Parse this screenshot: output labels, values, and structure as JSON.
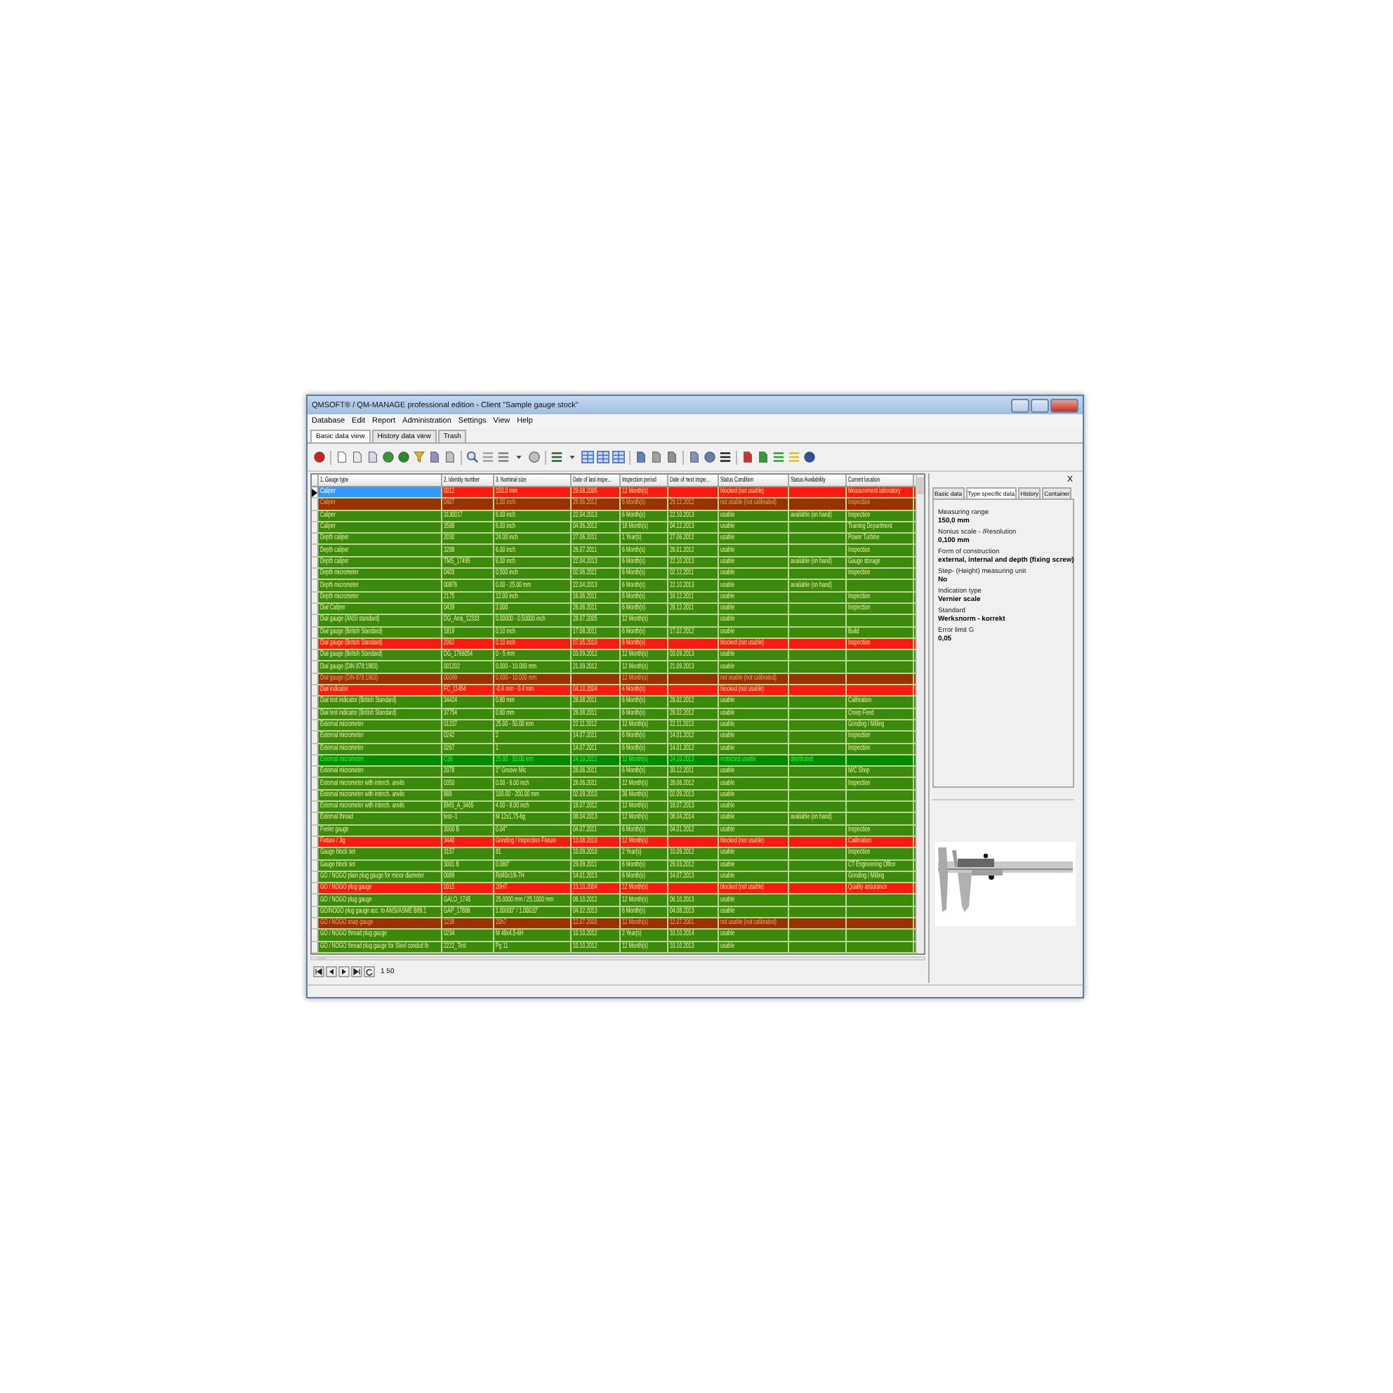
{
  "window": {
    "title": "QMSOFT® / QM-MANAGE professional edition - Client \"Sample gauge stock\""
  },
  "menu": [
    "Database",
    "Edit",
    "Report",
    "Administration",
    "Settings",
    "View",
    "Help"
  ],
  "tabs": [
    {
      "label": "Basic data view",
      "selected": true
    },
    {
      "label": "History data view",
      "selected": false
    },
    {
      "label": "Trash",
      "selected": false
    }
  ],
  "table": {
    "columns": [
      "1. Gauge type",
      "2. Identity number",
      "3. Nominal size",
      "Date of last inspe...",
      "Inspection period",
      "Date of next inspe...",
      "Status Condition",
      "Status Availability",
      "Current location"
    ],
    "rows": [
      {
        "kind": "red",
        "selected": true,
        "gauge_type": "Caliper",
        "identity_number": "0012",
        "nominal_size": "150.0 mm",
        "last_inspection": "29.08.2005",
        "inspection_period": "12 Month(s)",
        "condition": "blocked (not usable)",
        "location": "Measurement laboratory"
      },
      {
        "kind": "brown",
        "selected": false,
        "gauge_type": "Caliper",
        "identity_number": "0407",
        "nominal_size": "1.00 inch",
        "last_inspection": "29.06.2012",
        "inspection_period": "6 Month(s)",
        "next_inspection": "29.12.2012",
        "condition": "not usable (not calibrated)",
        "location": "Inspection"
      },
      {
        "kind": "green",
        "selected": false,
        "gauge_type": "Caliper",
        "identity_number": "3130017",
        "nominal_size": "6.00 inch",
        "last_inspection": "22.04.2013",
        "inspection_period": "6 Month(s)",
        "next_inspection": "22.10.2013",
        "condition": "usable",
        "availability": "available (on hand)",
        "location": "Inspection"
      },
      {
        "kind": "green",
        "selected": false,
        "gauge_type": "Caliper",
        "identity_number": "3588",
        "nominal_size": "6.00 inch",
        "last_inspection": "04.06.2012",
        "inspection_period": "18 Month(s)",
        "next_inspection": "04.12.2013",
        "condition": "usable",
        "location": "Training Department"
      },
      {
        "kind": "green",
        "selected": false,
        "gauge_type": "Depth caliper",
        "identity_number": "2030",
        "nominal_size": "24.00 inch",
        "last_inspection": "27.06.2011",
        "inspection_period": "1 Year(s)",
        "next_inspection": "27.06.2012",
        "condition": "usable",
        "location": "Power Turbine"
      },
      {
        "kind": "green",
        "selected": false,
        "gauge_type": "Depth caliper",
        "identity_number": "3288",
        "nominal_size": "6.00 inch",
        "last_inspection": "26.07.2011",
        "inspection_period": "6 Month(s)",
        "next_inspection": "26.01.2012",
        "condition": "usable",
        "location": "Inspection"
      },
      {
        "kind": "green",
        "selected": false,
        "gauge_type": "Depth caliper",
        "identity_number": "TMS_17495",
        "nominal_size": "6.00 inch",
        "last_inspection": "22.04.2013",
        "inspection_period": "6 Month(s)",
        "next_inspection": "22.10.2013",
        "condition": "usable",
        "availability": "available (on hand)",
        "location": "Gauge storage"
      },
      {
        "kind": "green",
        "selected": false,
        "gauge_type": "Depth micrometer",
        "identity_number": "0403",
        "nominal_size": "0.500 inch",
        "last_inspection": "02.06.2011",
        "inspection_period": "6 Month(s)",
        "next_inspection": "02.12.2011",
        "condition": "usable",
        "location": "Inspection"
      },
      {
        "kind": "green",
        "selected": false,
        "gauge_type": "Depth micrometer",
        "identity_number": "00876",
        "nominal_size": "0.00 - 25.00 mm",
        "last_inspection": "22.04.2013",
        "inspection_period": "6 Month(s)",
        "next_inspection": "22.10.2013",
        "condition": "usable",
        "availability": "available (on hand)"
      },
      {
        "kind": "green",
        "selected": false,
        "gauge_type": "Depth micrometer",
        "identity_number": "2175",
        "nominal_size": "12.00 inch",
        "last_inspection": "16.06.2011",
        "inspection_period": "6 Month(s)",
        "next_inspection": "16.12.2011",
        "condition": "usable",
        "location": "Inspection"
      },
      {
        "kind": "green",
        "selected": false,
        "gauge_type": "Dial Caliper",
        "identity_number": "0439",
        "nominal_size": "2.000",
        "last_inspection": "28.06.2011",
        "inspection_period": "6 Month(s)",
        "next_inspection": "28.12.2011",
        "condition": "usable",
        "location": "Inspection"
      },
      {
        "kind": "green",
        "selected": false,
        "gauge_type": "Dial gauge (ANSI standard)",
        "identity_number": "DG_Ansi_12333",
        "nominal_size": "0.00000 - 0.50000 inch",
        "last_inspection": "28.07.2005",
        "inspection_period": "12 Month(s)",
        "condition": "usable"
      },
      {
        "kind": "green",
        "selected": false,
        "gauge_type": "Dial gauge (British Standard)",
        "identity_number": "1819",
        "nominal_size": "0.10 inch",
        "last_inspection": "17.08.2011",
        "inspection_period": "6 Month(s)",
        "next_inspection": "17.02.2012",
        "condition": "usable",
        "location": "Build"
      },
      {
        "kind": "red",
        "selected": false,
        "gauge_type": "Dial gauge (British Standard)",
        "identity_number": "2062",
        "nominal_size": "0.10 inch",
        "last_inspection": "07.05.2010",
        "inspection_period": "6 Month(s)",
        "condition": "blocked (not usable)",
        "location": "Inspection"
      },
      {
        "kind": "green",
        "selected": false,
        "gauge_type": "Dial gauge (British Standard)",
        "identity_number": "DG_1766054",
        "nominal_size": "0 - 5 mm",
        "last_inspection": "03.09.2012",
        "inspection_period": "12 Month(s)",
        "next_inspection": "03.09.2013",
        "condition": "usable"
      },
      {
        "kind": "green",
        "selected": false,
        "gauge_type": "Dial gauge (DIN 878:1983)",
        "identity_number": "001202",
        "nominal_size": "0.000 - 10.000 mm",
        "last_inspection": "21.09.2012",
        "inspection_period": "12 Month(s)",
        "next_inspection": "21.09.2013",
        "condition": "usable"
      },
      {
        "kind": "brown",
        "selected": false,
        "gauge_type": "Dial gauge (DIN 878:1983)",
        "identity_number": "00099",
        "nominal_size": "0.000 - 10.000 mm",
        "inspection_period": "12 Month(s)",
        "condition": "not usable (not calibrated)"
      },
      {
        "kind": "red",
        "selected": false,
        "gauge_type": "Dial indicator",
        "identity_number": "FC_11454",
        "nominal_size": "-0.4 mm - 0.4 mm",
        "last_inspection": "04.10.2004",
        "inspection_period": "4 Month(s)",
        "condition": "blocked (not usable)"
      },
      {
        "kind": "green",
        "selected": false,
        "gauge_type": "Dial test indicator (British Standard)",
        "identity_number": "34424",
        "nominal_size": "0.80 mm",
        "last_inspection": "28.08.2011",
        "inspection_period": "6 Month(s)",
        "next_inspection": "28.02.2012",
        "condition": "usable",
        "location": "Calibration"
      },
      {
        "kind": "green",
        "selected": false,
        "gauge_type": "Dial test indicator (British Standard)",
        "identity_number": "37754",
        "nominal_size": "0.80 mm",
        "last_inspection": "28.08.2011",
        "inspection_period": "6 Month(s)",
        "next_inspection": "28.02.2012",
        "condition": "usable",
        "location": "Creep Feed"
      },
      {
        "kind": "green",
        "selected": false,
        "gauge_type": "External micrometer",
        "identity_number": "01237",
        "nominal_size": "25.00 - 50.00 mm",
        "last_inspection": "22.11.2012",
        "inspection_period": "12 Month(s)",
        "next_inspection": "22.11.2013",
        "condition": "usable",
        "location": "Grinding / Milling"
      },
      {
        "kind": "green",
        "selected": false,
        "gauge_type": "External micrometer",
        "identity_number": "0242",
        "nominal_size": "2",
        "last_inspection": "14.07.2011",
        "inspection_period": "6 Month(s)",
        "next_inspection": "14.01.2012",
        "condition": "usable",
        "location": "Inspection"
      },
      {
        "kind": "green",
        "selected": false,
        "gauge_type": "External micrometer",
        "identity_number": "0267",
        "nominal_size": "1",
        "last_inspection": "14.07.2011",
        "inspection_period": "6 Month(s)",
        "next_inspection": "14.01.2012",
        "condition": "usable",
        "location": "Inspection"
      },
      {
        "kind": "bright",
        "selected": false,
        "gauge_type": "External micrometer",
        "identity_number": "C36",
        "nominal_size": "25.00 - 50.00 mm",
        "last_inspection": "24.10.2012",
        "inspection_period": "12 Month(s)",
        "next_inspection": "24.10.2013",
        "condition": "restricted usable",
        "availability": "distributed"
      },
      {
        "kind": "green",
        "selected": false,
        "gauge_type": "External micrometer",
        "identity_number": "2078",
        "nominal_size": "1\" Groove Mic",
        "last_inspection": "28.06.2011",
        "inspection_period": "6 Month(s)",
        "next_inspection": "30.12.2011",
        "condition": "usable",
        "location": "M/C Shop"
      },
      {
        "kind": "green",
        "selected": false,
        "gauge_type": "External micrometer with interch. anvils",
        "identity_number": "0350",
        "nominal_size": "0.00 - 6.00 inch",
        "last_inspection": "28.06.2011",
        "inspection_period": "12 Month(s)",
        "next_inspection": "28.06.2012",
        "condition": "usable",
        "location": "Inspection"
      },
      {
        "kind": "green",
        "selected": false,
        "gauge_type": "External micrometer with interch. anvils",
        "identity_number": "888",
        "nominal_size": "100.00 - 200.00 mm",
        "last_inspection": "02.09.2010",
        "inspection_period": "36 Month(s)",
        "next_inspection": "02.09.2013",
        "condition": "usable"
      },
      {
        "kind": "green",
        "selected": false,
        "gauge_type": "External micrometer with interch. anvils",
        "identity_number": "BMS_A_3465",
        "nominal_size": "4.00 - 8.00 inch",
        "last_inspection": "18.07.2012",
        "inspection_period": "12 Month(s)",
        "next_inspection": "18.07.2013",
        "condition": "usable"
      },
      {
        "kind": "green",
        "selected": false,
        "gauge_type": "External thread",
        "identity_number": "test--1",
        "nominal_size": "M 12x1.75-6g",
        "last_inspection": "08.04.2013",
        "inspection_period": "12 Month(s)",
        "next_inspection": "08.04.2014",
        "condition": "usable",
        "availability": "available (on hand)"
      },
      {
        "kind": "green",
        "selected": false,
        "gauge_type": "Feeler gauge",
        "identity_number": "3000 B",
        "nominal_size": "0.04\"",
        "last_inspection": "04.07.2011",
        "inspection_period": "6 Month(s)",
        "next_inspection": "04.01.2012",
        "condition": "usable",
        "location": "Inspection"
      },
      {
        "kind": "red",
        "selected": false,
        "gauge_type": "Fixture / Jig",
        "identity_number": "3440",
        "nominal_size": "Grinding / Inspection Fixture",
        "last_inspection": "13.08.2010",
        "inspection_period": "12 Month(s)",
        "condition": "blocked (not usable)",
        "location": "Calibration"
      },
      {
        "kind": "green",
        "selected": false,
        "gauge_type": "Gauge block set",
        "identity_number": "3157",
        "nominal_size": "81",
        "last_inspection": "10.09.2010",
        "inspection_period": "2 Year(s)",
        "next_inspection": "10.09.2012",
        "condition": "usable",
        "location": "Inspection"
      },
      {
        "kind": "green",
        "selected": false,
        "gauge_type": "Gauge block set",
        "identity_number": "3001 B",
        "nominal_size": "0.080\"",
        "last_inspection": "29.09.2011",
        "inspection_period": "6 Month(s)",
        "next_inspection": "29.03.2012",
        "condition": "usable",
        "location": "CT Engineering Office"
      },
      {
        "kind": "green",
        "selected": false,
        "gauge_type": "GO / NOGO plain plug gauge for minor diameter",
        "identity_number": "0089",
        "nominal_size": "Rd40x1/6-7H",
        "last_inspection": "14.01.2013",
        "inspection_period": "6 Month(s)",
        "next_inspection": "14.07.2013",
        "condition": "usable",
        "location": "Grinding / Milling"
      },
      {
        "kind": "red",
        "selected": false,
        "gauge_type": "GO / NOGO plug gauge",
        "identity_number": "0015",
        "nominal_size": "20H7",
        "last_inspection": "13.10.2004",
        "inspection_period": "12 Month(s)",
        "condition": "blocked (not usable)",
        "location": "Quality assurance"
      },
      {
        "kind": "green",
        "selected": false,
        "gauge_type": "GO / NOGO plug gauge",
        "identity_number": "GALO_1745",
        "nominal_size": "25.0000 mm / 25.1000 mm",
        "last_inspection": "06.10.2012",
        "inspection_period": "12 Month(s)",
        "next_inspection": "06.10.2013",
        "condition": "usable"
      },
      {
        "kind": "green",
        "selected": false,
        "gauge_type": "GO/NOGO plug gauge acc. to ANSI/ASME B89.1",
        "identity_number": "GAP_17888",
        "nominal_size": "1.00000\" / 1.00020\"",
        "last_inspection": "04.02.2013",
        "inspection_period": "6 Month(s)",
        "next_inspection": "04.08.2013",
        "condition": "usable"
      },
      {
        "kind": "brown",
        "selected": false,
        "gauge_type": "GO / NOGO snap gauge",
        "identity_number": "1238",
        "nominal_size": "20h7",
        "last_inspection": "12.07.2000",
        "inspection_period": "12 Month(s)",
        "next_inspection": "12.07.2001",
        "condition": "not usable (not calibrated)"
      },
      {
        "kind": "green",
        "selected": false,
        "gauge_type": "GO / NOGO thread plug gauge",
        "identity_number": "0234",
        "nominal_size": "M 48x4.5-6H",
        "last_inspection": "10.10.2012",
        "inspection_period": "2 Year(s)",
        "next_inspection": "10.10.2014",
        "condition": "usable"
      },
      {
        "kind": "green",
        "selected": false,
        "gauge_type": "GO / NOGO thread plug gauge for Steel conduit th",
        "identity_number": "2222_Test",
        "nominal_size": "Pg 11",
        "last_inspection": "10.10.2012",
        "inspection_period": "12 Month(s)",
        "next_inspection": "10.10.2013",
        "condition": "usable"
      }
    ]
  },
  "pager": {
    "text": "1 50"
  },
  "detail_panel": {
    "close": "X",
    "tabs": [
      {
        "label": "Basic data",
        "selected": false
      },
      {
        "label": "Type specific data",
        "selected": true
      },
      {
        "label": "History",
        "selected": false
      },
      {
        "label": "Container",
        "selected": false
      }
    ],
    "fields": [
      {
        "label": "Measuring range",
        "value": "150,0 mm"
      },
      {
        "label": "Nonius scale - /Resolution",
        "value": "0,100 mm"
      },
      {
        "label": "Form of construction",
        "value": "external, internal and depth (fixing screw)"
      },
      {
        "label": "Step- (Height) measuring unit",
        "value": "No"
      },
      {
        "label": "Indication type",
        "value": "Vernier scale"
      },
      {
        "label": "Standard",
        "value": "Werksnorm - korrekt"
      },
      {
        "label": "Error limit G",
        "value": "0,05"
      }
    ]
  }
}
